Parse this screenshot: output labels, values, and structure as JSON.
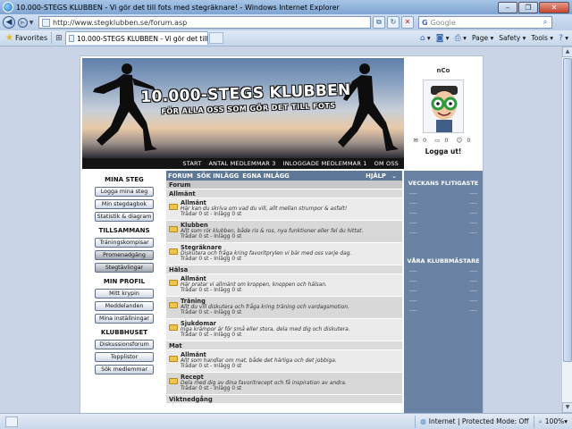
{
  "window": {
    "title": "10.000-STEGS KLUBBEN - Vi gör det till fots med stegräknare! - Windows Internet Explorer"
  },
  "address": {
    "url": "http://www.stegklubben.se/forum.asp",
    "search_placeholder": "Google"
  },
  "tabbar": {
    "favorites_label": "Favorites",
    "tab_title": "10.000-STEGS KLUBBEN - Vi gör det till fots med s...",
    "commands": {
      "page": "Page",
      "safety": "Safety",
      "tools": "Tools"
    }
  },
  "banner": {
    "headline": "10.000-STEGS KLUBBEN",
    "subheadline": "FÖR ALLA OSS SOM GÖR DET TILL FOTS",
    "stats": [
      "START",
      "ANTAL MEDLEMMAR 3",
      "INLOGGADE MEDLEMMAR 1",
      "OM OSS"
    ]
  },
  "profile": {
    "username": "nCo",
    "counts": [
      "0",
      "0",
      "0"
    ],
    "logout_label": "Logga ut!"
  },
  "leftmenu": {
    "sections": [
      {
        "title": "MINA STEG",
        "buttons": [
          "Logga mina steg",
          "Min stegdagbok",
          "Statistik & diagram"
        ]
      },
      {
        "title": "TILLSAMMANS",
        "buttons": [
          "Träningskompisar",
          "Promenadgäng",
          "Stegtävlingar"
        ]
      },
      {
        "title": "MIN PROFIL",
        "buttons": [
          "Mitt krypin",
          "Meddelanden",
          "Mina inställningar"
        ]
      },
      {
        "title": "KLUBBHUSET",
        "buttons": [
          "Diskussionsforum",
          "Topplistor",
          "Sök medlemmar"
        ]
      }
    ]
  },
  "forum": {
    "tabs": [
      "FORUM",
      "SÖK INLÄGG",
      "EGNA INLÄGG"
    ],
    "help_label": "HJÄLP",
    "header": "Forum",
    "categories": [
      {
        "name": "Allmänt",
        "rows": [
          {
            "title": "Allmänt",
            "desc": "Här kan du skriva om vad du vill, allt mellan strumpor & asfalt!",
            "stats": "Trådar 0 st - Inlägg 0 st"
          },
          {
            "title": "Klubben",
            "desc": "Allt som rör klubben, både ris & ros, nya funktioner eller fel du hittat.",
            "stats": "Trådar 0 st - Inlägg 0 st"
          },
          {
            "title": "Stegräknare",
            "desc": "Diskutera och fråga kring favoritprylen vi bär med oss varje dag.",
            "stats": "Trådar 0 st - Inlägg 0 st"
          }
        ]
      },
      {
        "name": "Hälsa",
        "rows": [
          {
            "title": "Allmänt",
            "desc": "Här pratar vi allmänt om kroppen, knoppen och hälsan.",
            "stats": "Trådar 0 st - Inlägg 0 st"
          },
          {
            "title": "Träning",
            "desc": "Allt du vill diskutera och fråga kring träning och vardagsmotion.",
            "stats": "Trådar 0 st - Inlägg 0 st"
          },
          {
            "title": "Sjukdomar",
            "desc": "Inga krämpor är för små eller stora, dela med dig och diskutera.",
            "stats": "Trådar 0 st - Inlägg 0 st"
          }
        ]
      },
      {
        "name": "Mat",
        "rows": [
          {
            "title": "Allmänt",
            "desc": "Allt som handlar om mat, både det härliga och det jobbiga.",
            "stats": "Trådar 0 st - Inlägg 0 st"
          },
          {
            "title": "Recept",
            "desc": "Dela med dig av dina favoritrecept och få inspiration av andra.",
            "stats": "Trådar 0 st - Inlägg 0 st"
          }
        ]
      },
      {
        "name": "Viktnedgång",
        "rows": []
      }
    ]
  },
  "rightpanel": {
    "flitigaste_title": "VECKANS FLITIGASTE",
    "flitigaste_rows": [
      [
        "----",
        "----"
      ],
      [
        "----",
        "----"
      ],
      [
        "----",
        "----"
      ],
      [
        "----",
        "----"
      ],
      [
        "----",
        "----"
      ]
    ],
    "mastare_title": "VÅRA KLUBBMÄSTARE",
    "mastare_rows": [
      [
        "----",
        "----"
      ],
      [
        "----",
        "----"
      ],
      [
        "----",
        "----"
      ],
      [
        "----",
        "----"
      ],
      [
        "----",
        "----"
      ]
    ]
  },
  "statusbar": {
    "zone": "Internet | Protected Mode: Off",
    "zoom": "100%"
  }
}
